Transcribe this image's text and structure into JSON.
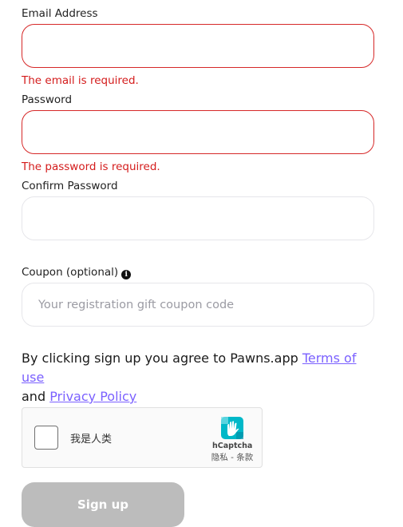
{
  "form": {
    "email": {
      "label": "Email Address",
      "value": "",
      "placeholder": "",
      "error": "The email is required."
    },
    "password": {
      "label": "Password",
      "value": "",
      "placeholder": "",
      "error": "The password is required."
    },
    "confirm_password": {
      "label": "Confirm Password",
      "value": "",
      "placeholder": ""
    },
    "coupon": {
      "label": "Coupon (optional)",
      "value": "",
      "placeholder": "Your registration gift coupon code",
      "info_icon": "info-icon"
    },
    "agreement": {
      "prefix": "By clicking sign up you agree to Pawns.app ",
      "terms_link": "Terms of use",
      "middle": "and ",
      "privacy_link": "Privacy Policy"
    },
    "captcha": {
      "checkbox_label": "我是人类",
      "brand": "hCaptcha",
      "privacy_link": "隐私",
      "separator": " - ",
      "terms_link": "条款",
      "checked": false
    },
    "submit_label": "Sign up"
  },
  "colors": {
    "error": "#d41c1c",
    "error_border": "#d62828",
    "link": "#7b61ff",
    "button_disabled": "#bcbcbc",
    "hcaptcha_teal": "#00b8c8"
  }
}
